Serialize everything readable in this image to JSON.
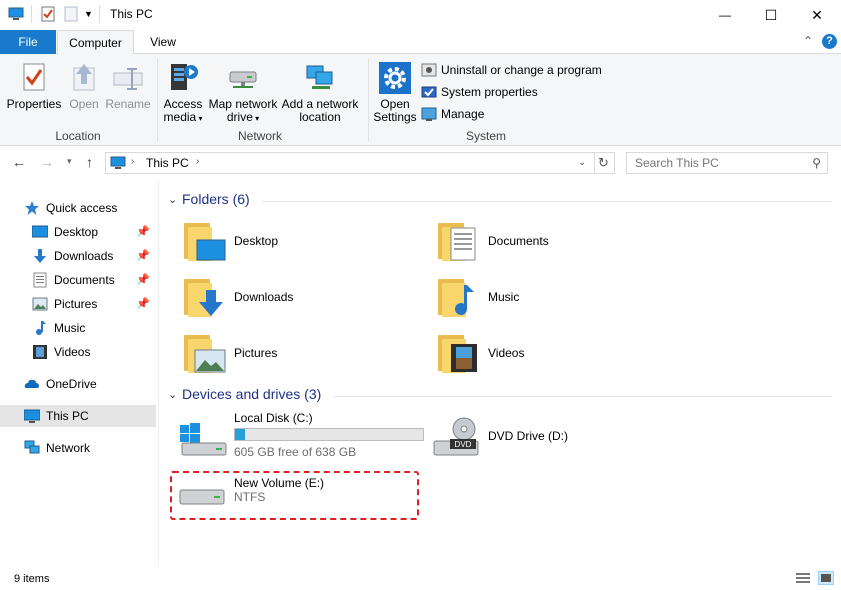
{
  "window": {
    "title": "This PC",
    "minimize": "—",
    "maximize": "☐",
    "close": "✕"
  },
  "ribbon_tabs": {
    "file": "File",
    "computer": "Computer",
    "view": "View"
  },
  "ribbon": {
    "location": {
      "label": "Location",
      "properties": "Properties",
      "open": "Open",
      "rename": "Rename"
    },
    "network": {
      "label": "Network",
      "access_media_1": "Access",
      "access_media_2": "media",
      "map_drive_1": "Map network",
      "map_drive_2": "drive",
      "add_location_1": "Add a network",
      "add_location_2": "location"
    },
    "system": {
      "label": "System",
      "open_settings_1": "Open",
      "open_settings_2": "Settings",
      "uninstall": "Uninstall or change a program",
      "system_properties": "System properties",
      "manage": "Manage"
    }
  },
  "address": {
    "path": "This PC",
    "search_placeholder": "Search This PC"
  },
  "sidebar": {
    "quick_access": "Quick access",
    "items": [
      {
        "label": "Desktop"
      },
      {
        "label": "Downloads"
      },
      {
        "label": "Documents"
      },
      {
        "label": "Pictures"
      },
      {
        "label": "Music"
      },
      {
        "label": "Videos"
      }
    ],
    "onedrive": "OneDrive",
    "this_pc": "This PC",
    "network": "Network"
  },
  "folders": {
    "header": "Folders (6)",
    "items": [
      {
        "label": "Desktop"
      },
      {
        "label": "Documents"
      },
      {
        "label": "Downloads"
      },
      {
        "label": "Music"
      },
      {
        "label": "Pictures"
      },
      {
        "label": "Videos"
      }
    ]
  },
  "drives": {
    "header": "Devices and drives (3)",
    "items": [
      {
        "name": "Local Disk (C:)",
        "detail": "605 GB free of 638 GB",
        "used_fraction": 0.052
      },
      {
        "name": "DVD Drive (D:)",
        "badge": "DVD"
      },
      {
        "name": "New Volume (E:)",
        "detail": "NTFS"
      }
    ]
  },
  "status": {
    "count": "9 items"
  },
  "colors": {
    "accent": "#1979ca",
    "header_text": "#1e3287",
    "selection": "#e5e5e5",
    "highlight": "#e02020",
    "progress": "#26a0da"
  }
}
